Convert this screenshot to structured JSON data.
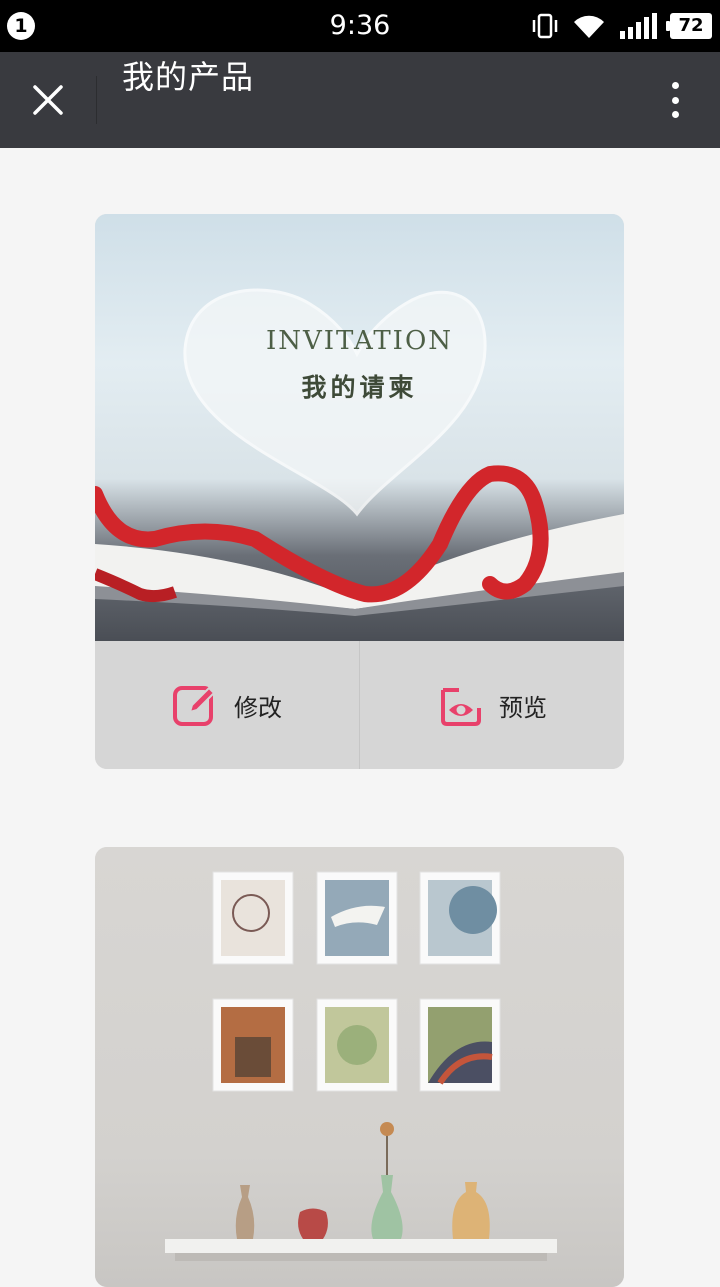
{
  "status_bar": {
    "notification_count": "1",
    "time": "9:36",
    "battery": "72",
    "icons": [
      "vibrate-icon",
      "wifi-icon",
      "signal-icon",
      "battery-icon"
    ]
  },
  "title_bar": {
    "title": "我的产品",
    "close_icon": "close-icon",
    "more_icon": "more-vertical-icon"
  },
  "products": [
    {
      "image_text_en": "INVITATION",
      "image_text_cn": "我的请柬",
      "actions": [
        {
          "label": "修改",
          "icon": "edit-icon"
        },
        {
          "label": "预览",
          "icon": "preview-eye-icon"
        }
      ]
    },
    {
      "image_text_en": "",
      "image_text_cn": ""
    }
  ],
  "colors": {
    "accent": "#e8416b",
    "title_bar_bg": "#393a3f",
    "page_bg": "#f5f5f5",
    "action_bar_bg": "#d6d6d6"
  }
}
